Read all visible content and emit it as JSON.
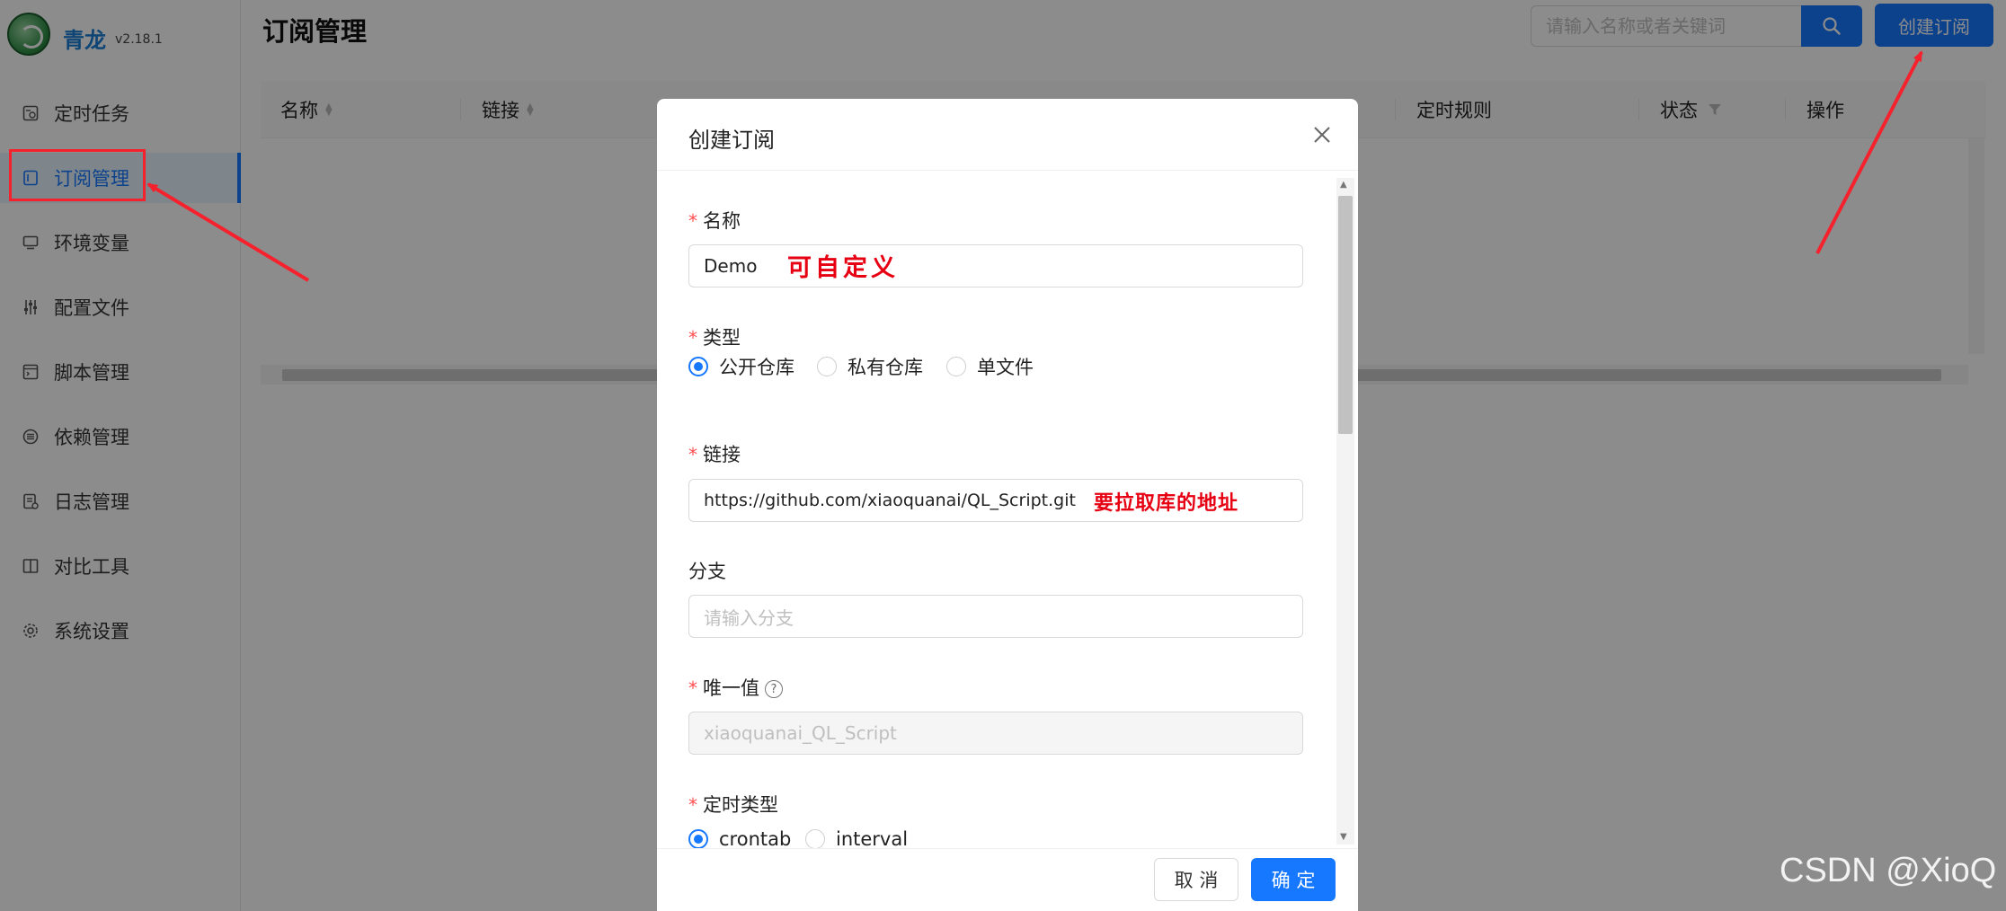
{
  "app": {
    "brand": "青龙",
    "version": "v2.18.1"
  },
  "sidebar": {
    "items": [
      {
        "label": "定时任务",
        "icon": "schedule-icon"
      },
      {
        "label": "订阅管理",
        "icon": "subscription-icon",
        "active": true
      },
      {
        "label": "环境变量",
        "icon": "environment-icon"
      },
      {
        "label": "配置文件",
        "icon": "config-icon"
      },
      {
        "label": "脚本管理",
        "icon": "script-icon"
      },
      {
        "label": "依赖管理",
        "icon": "dependency-icon"
      },
      {
        "label": "日志管理",
        "icon": "log-icon"
      },
      {
        "label": "对比工具",
        "icon": "diff-icon"
      },
      {
        "label": "系统设置",
        "icon": "settings-icon"
      }
    ]
  },
  "header": {
    "title": "订阅管理",
    "search_placeholder": "请输入名称或者关键词",
    "create_label": "创建订阅"
  },
  "table": {
    "columns": [
      "名称",
      "链接",
      "定时规则",
      "状态",
      "操作"
    ]
  },
  "modal": {
    "title": "创建订阅",
    "name_label": "名称",
    "name_value": "Demo",
    "name_note": "可自定义",
    "type_label": "类型",
    "type_options": [
      "公开仓库",
      "私有仓库",
      "单文件"
    ],
    "type_selected": "公开仓库",
    "url_label": "链接",
    "url_value": "https://github.com/xiaoquanai/QL_Script.git",
    "url_note": "要拉取库的地址",
    "branch_label": "分支",
    "branch_placeholder": "请输入分支",
    "unique_label": "唯一值",
    "unique_value": "xiaoquanai_QL_Script",
    "schedule_type_label": "定时类型",
    "schedule_options": [
      "crontab",
      "interval"
    ],
    "cancel_label": "取 消",
    "ok_label": "确 定"
  },
  "watermark": "CSDN @XioQ",
  "colors": {
    "primary": "#1677ff",
    "annotation": "#e60012"
  }
}
